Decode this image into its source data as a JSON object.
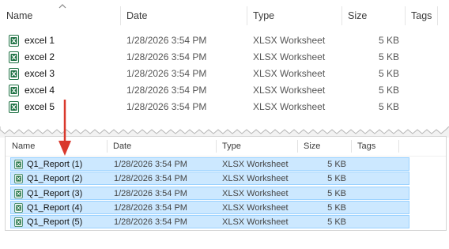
{
  "colors": {
    "selection_bg": "#cce8ff",
    "selection_border": "#99d1ff",
    "excel_green": "#1f7244",
    "arrow_red": "#d9382c"
  },
  "top": {
    "columns": {
      "name": "Name",
      "date": "Date",
      "type": "Type",
      "size": "Size",
      "tags": "Tags"
    },
    "files": [
      {
        "name": "excel 1",
        "date": "1/28/2026 3:54 PM",
        "type": "XLSX Worksheet",
        "size": "5 KB",
        "icon": "excel-file-icon"
      },
      {
        "name": "excel 2",
        "date": "1/28/2026 3:54 PM",
        "type": "XLSX Worksheet",
        "size": "5 KB",
        "icon": "excel-file-icon"
      },
      {
        "name": "excel 3",
        "date": "1/28/2026 3:54 PM",
        "type": "XLSX Worksheet",
        "size": "5 KB",
        "icon": "excel-file-icon"
      },
      {
        "name": "excel 4",
        "date": "1/28/2026 3:54 PM",
        "type": "XLSX Worksheet",
        "size": "5 KB",
        "icon": "excel-file-icon"
      },
      {
        "name": "excel 5",
        "date": "1/28/2026 3:54 PM",
        "type": "XLSX Worksheet",
        "size": "5 KB",
        "icon": "excel-file-icon"
      }
    ]
  },
  "bottom": {
    "columns": {
      "name": "Name",
      "date": "Date",
      "type": "Type",
      "size": "Size",
      "tags": "Tags"
    },
    "files": [
      {
        "name": "Q1_Report (1)",
        "date": "1/28/2026 3:54 PM",
        "type": "XLSX Worksheet",
        "size": "5 KB",
        "icon": "excel-file-icon"
      },
      {
        "name": "Q1_Report (2)",
        "date": "1/28/2026 3:54 PM",
        "type": "XLSX Worksheet",
        "size": "5 KB",
        "icon": "excel-file-icon"
      },
      {
        "name": "Q1_Report (3)",
        "date": "1/28/2026 3:54 PM",
        "type": "XLSX Worksheet",
        "size": "5 KB",
        "icon": "excel-file-icon"
      },
      {
        "name": "Q1_Report (4)",
        "date": "1/28/2026 3:54 PM",
        "type": "XLSX Worksheet",
        "size": "5 KB",
        "icon": "excel-file-icon"
      },
      {
        "name": "Q1_Report (5)",
        "date": "1/28/2026 3:54 PM",
        "type": "XLSX Worksheet",
        "size": "5 KB",
        "icon": "excel-file-icon"
      }
    ]
  }
}
